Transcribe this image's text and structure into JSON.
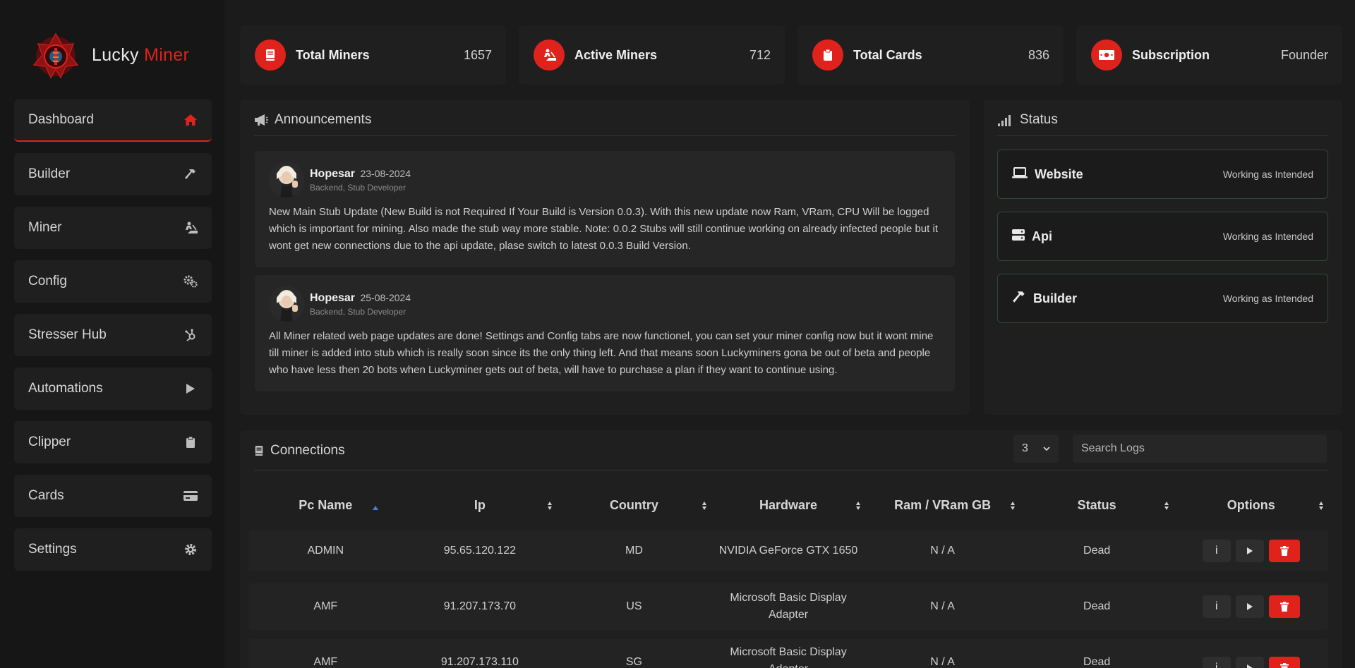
{
  "brand": {
    "name_part1": "Lucky",
    "name_part2": "Miner",
    "accent_color": "#e0221c"
  },
  "sidebar": {
    "items": [
      {
        "label": "Dashboard",
        "icon": "home-icon",
        "active": true
      },
      {
        "label": "Builder",
        "icon": "hammer-icon"
      },
      {
        "label": "Miner",
        "icon": "person-digging-icon"
      },
      {
        "label": "Config",
        "icon": "gears-icon"
      },
      {
        "label": "Stresser Hub",
        "icon": "hubspot-icon"
      },
      {
        "label": "Automations",
        "icon": "play-icon"
      },
      {
        "label": "Clipper",
        "icon": "clipboard-icon"
      },
      {
        "label": "Cards",
        "icon": "credit-card-icon"
      },
      {
        "label": "Settings",
        "icon": "gear-icon"
      }
    ]
  },
  "stats": [
    {
      "label": "Total Miners",
      "value": "1657",
      "icon": "book-icon"
    },
    {
      "label": "Active Miners",
      "value": "712",
      "icon": "person-digging-icon"
    },
    {
      "label": "Total Cards",
      "value": "836",
      "icon": "clipboard-icon"
    },
    {
      "label": "Subscription",
      "value": "Founder",
      "icon": "money-bill-icon"
    }
  ],
  "announcements": {
    "title": "Announcements",
    "items": [
      {
        "author": "Hopesar",
        "date": "23-08-2024",
        "role": "Backend, Stub Developer",
        "body": "New Main Stub Update (New Build is not Required If Your Build is Version 0.0.3). With this new update now Ram, VRam, CPU Will be logged which is important for mining. Also made the stub way more stable. Note: 0.0.2 Stubs will still continue working on already infected people but it wont get new connections due to the api update, plase switch to latest 0.0.3 Build Version."
      },
      {
        "author": "Hopesar",
        "date": "25-08-2024",
        "role": "Backend, Stub Developer",
        "body": "All Miner related web page updates are done! Settings and Config tabs are now functionel, you can set your miner config now but it wont mine till miner is added into stub which is really soon since its the only thing left. And that means soon Luckyminers gona be out of beta and people who have less then 20 bots when Luckyminer gets out of beta, will have to purchase a plan if they want to continue using."
      }
    ]
  },
  "status": {
    "title": "Status",
    "items": [
      {
        "name": "Website",
        "state": "Working as Intended",
        "icon": "laptop-icon"
      },
      {
        "name": "Api",
        "state": "Working as Intended",
        "icon": "server-icon"
      },
      {
        "name": "Builder",
        "state": "Working as Intended",
        "icon": "hammer-icon"
      }
    ]
  },
  "connections": {
    "title": "Connections",
    "page_size": "3",
    "search_placeholder": "Search Logs",
    "columns": [
      "Pc Name",
      "Ip",
      "Country",
      "Hardware",
      "Ram / VRam GB",
      "Status",
      "Options"
    ],
    "rows": [
      {
        "pc_name": "ADMIN",
        "ip": "95.65.120.122",
        "country": "MD",
        "hardware": "NVIDIA GeForce GTX 1650",
        "ram": "N / A",
        "status": "Dead"
      },
      {
        "pc_name": "AMF",
        "ip": "91.207.173.70",
        "country": "US",
        "hardware": "Microsoft Basic Display Adapter",
        "ram": "N / A",
        "status": "Dead"
      },
      {
        "pc_name": "AMF",
        "ip": "91.207.173.110",
        "country": "SG",
        "hardware": "Microsoft Basic Display Adapter",
        "ram": "N / A",
        "status": "Dead"
      }
    ],
    "option_info_label": "i"
  }
}
